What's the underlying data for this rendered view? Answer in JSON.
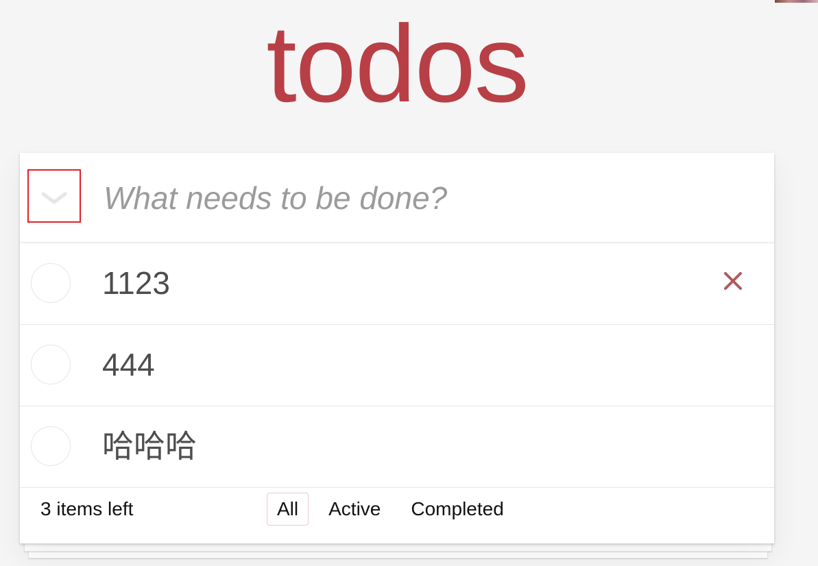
{
  "app": {
    "title": "todos"
  },
  "header": {
    "new_todo_placeholder": "What needs to be done?",
    "toggle_all_icon": "chevron-down-icon"
  },
  "todos": [
    {
      "label": "1123",
      "completed": false,
      "show_destroy": true
    },
    {
      "label": "444",
      "completed": false,
      "show_destroy": false
    },
    {
      "label": "哈哈哈",
      "completed": false,
      "show_destroy": false
    }
  ],
  "footer": {
    "count_text": "3 items left",
    "filters": [
      {
        "label": "All",
        "selected": true
      },
      {
        "label": "Active",
        "selected": false
      },
      {
        "label": "Completed",
        "selected": false
      }
    ]
  },
  "colors": {
    "title": "#b83f45",
    "destroy": "#af5b5e",
    "highlight_border": "#e0202a"
  }
}
